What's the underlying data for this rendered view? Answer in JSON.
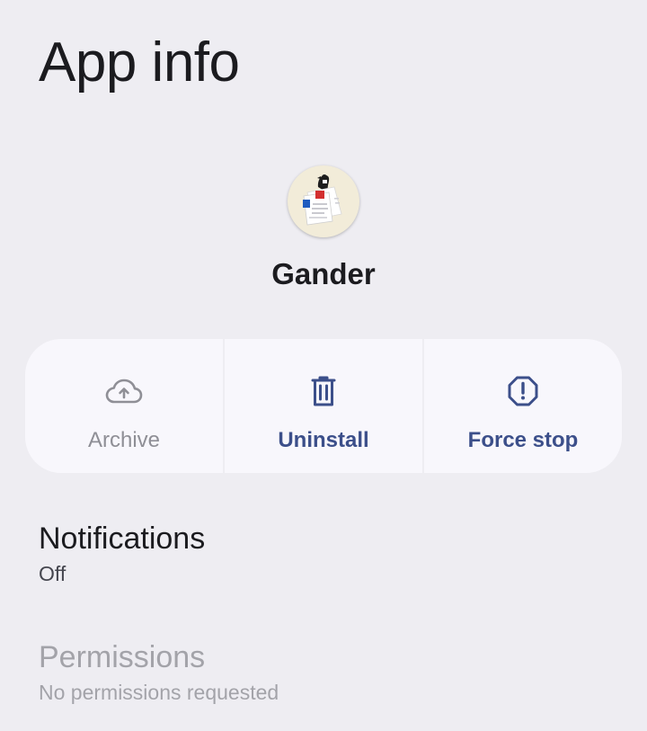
{
  "header": {
    "title": "App info"
  },
  "app": {
    "name": "Gander",
    "icon": "gander-app-icon"
  },
  "actions": [
    {
      "label": "Archive",
      "icon": "cloud-upload-icon",
      "enabled": false
    },
    {
      "label": "Uninstall",
      "icon": "trash-icon",
      "enabled": true
    },
    {
      "label": "Force stop",
      "icon": "alert-octagon-icon",
      "enabled": true
    }
  ],
  "settings": {
    "notifications": {
      "title": "Notifications",
      "summary": "Off",
      "enabled": true
    },
    "permissions": {
      "title": "Permissions",
      "summary": "No permissions requested",
      "enabled": false
    }
  },
  "colors": {
    "background": "#eeedf2",
    "card": "#f8f7fc",
    "accent": "#3c4f8a",
    "disabled": "#8f8f96"
  }
}
